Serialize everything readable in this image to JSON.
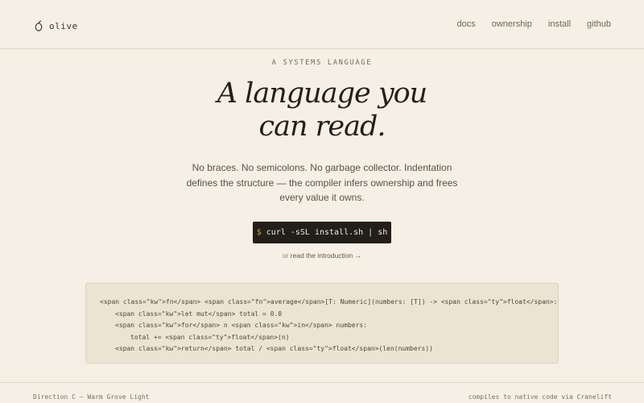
{
  "nav": {
    "brand": "olive",
    "brand_icon": "olive-leaf-icon",
    "links": [
      "docs",
      "ownership",
      "install",
      "github"
    ]
  },
  "hero": {
    "eyebrow": "A SYSTEMS LANGUAGE",
    "headline_line1": "A language you",
    "headline_line2": "can read.",
    "lede": "No braces. No semicolons. No garbage collector. Indentation defines the structure — the compiler infers ownership and frees every value it owns.",
    "install_prompt": "$",
    "install_command": "curl -sSL install.sh | sh",
    "intro_prefix": "or",
    "intro_link": "read the introduction →"
  },
  "code": {
    "lines": [
      "<span class=\"kw\">fn</span> <span class=\"fn\">average</span>[T: Numeric](numbers: [T]) -> <span class=\"ty\">float</span>:",
      "<span class=\"kw\">let mut</span> total = 0.0",
      "<span class=\"kw\">for</span> n <span class=\"kw\">in</span> numbers:",
      "total += <span class=\"ty\">float</span>(n)",
      "<span class=\"kw\">return</span> total / <span class=\"ty\">float</span>(len(numbers))"
    ]
  },
  "footer": {
    "left": "Direction C — Warm Grove Light",
    "right": "compiles to native code via Cranelift"
  },
  "colors": {
    "background": "#f5efe5",
    "ink": "#231f19",
    "button": "#221e19",
    "prompt_accent": "#c9a043",
    "code_bg": "#ece3d2"
  }
}
